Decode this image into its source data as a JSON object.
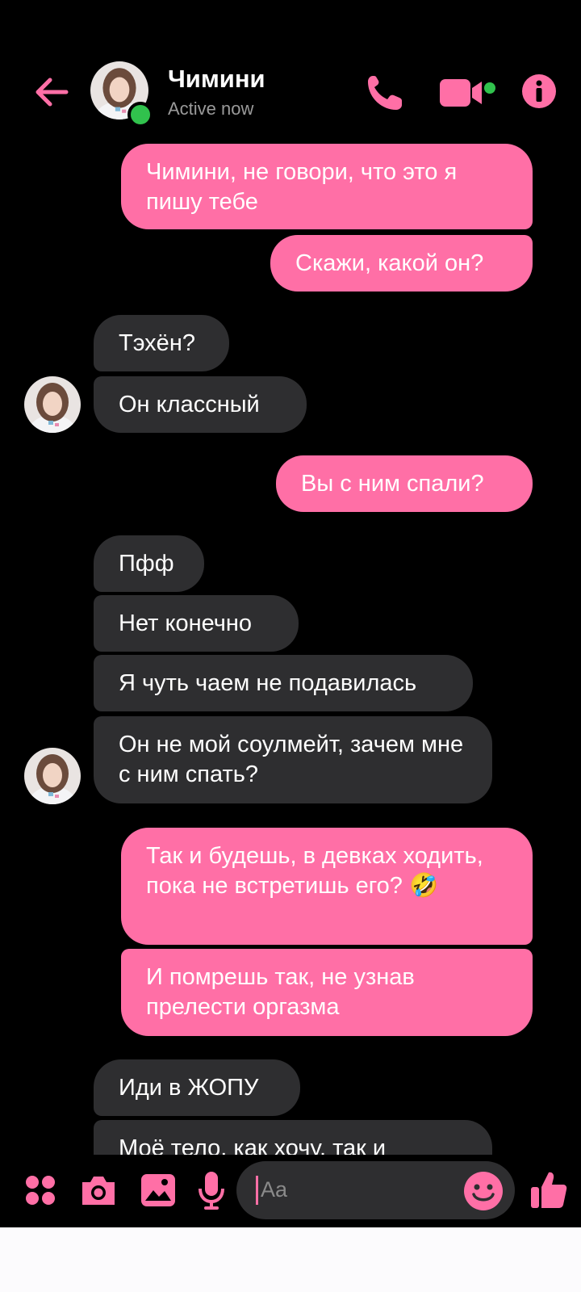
{
  "header": {
    "contact_name": "Чимини",
    "status": "Active now"
  },
  "messages": [
    {
      "id": "m1",
      "dir": "out",
      "text": "Чимини, не говори, что это я пишу тебе"
    },
    {
      "id": "m2",
      "dir": "out",
      "text": "Скажи, какой он?"
    },
    {
      "id": "m3",
      "dir": "in",
      "text": "Тэхён?"
    },
    {
      "id": "m4",
      "dir": "in",
      "text": "Он классный"
    },
    {
      "id": "m5",
      "dir": "out",
      "text": "Вы с ним спали?"
    },
    {
      "id": "m6",
      "dir": "in",
      "text": "Пфф"
    },
    {
      "id": "m7",
      "dir": "in",
      "text": "Нет конечно"
    },
    {
      "id": "m8",
      "dir": "in",
      "text": "Я чуть чаем не подавилась"
    },
    {
      "id": "m9",
      "dir": "in",
      "text": "Он не мой соулмейт, зачем мне с ним спать?"
    },
    {
      "id": "m10",
      "dir": "out",
      "text": "Так и будешь, в девках ходить, пока не встретишь его? 🤣"
    },
    {
      "id": "m11",
      "dir": "out",
      "text": "И помрешь так, не узнав прелести оргазма"
    },
    {
      "id": "m12",
      "dir": "in",
      "text": "Иди в ЖОПУ"
    },
    {
      "id": "m13",
      "dir": "in",
      "text": "Моё тело, как хочу, так и"
    }
  ],
  "composer": {
    "placeholder": "Aa"
  },
  "colors": {
    "accent": "#ff6fa6",
    "incoming_bubble": "#2e2e30",
    "background": "#000000",
    "online": "#31c24d"
  },
  "icons": [
    "back-arrow-icon",
    "phone-icon",
    "video-camera-icon",
    "info-icon",
    "apps-icon",
    "camera-icon",
    "gallery-icon",
    "microphone-icon",
    "emoji-icon",
    "thumbs-up-icon"
  ]
}
